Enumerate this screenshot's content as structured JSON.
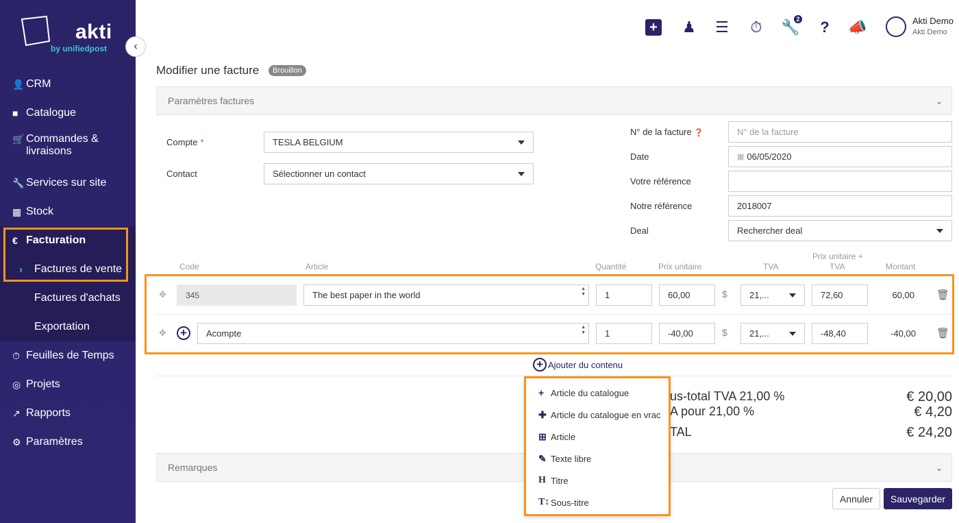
{
  "brand": {
    "name": "akti",
    "subtitle": "by unifiedpost",
    "primary_color": "#2b2367",
    "accent_color": "#3cc6c9",
    "highlight_color": "#f7941d"
  },
  "sidebar": {
    "items": [
      {
        "label": "CRM",
        "icon": "user-icon"
      },
      {
        "label": "Catalogue",
        "icon": "book-icon"
      },
      {
        "label": "Commandes & livraisons",
        "icon": "cart-icon"
      },
      {
        "label": "Services sur site",
        "icon": "wrench-icon"
      },
      {
        "label": "Stock",
        "icon": "cubes-icon"
      },
      {
        "label": "Facturation",
        "icon": "euro-icon"
      },
      {
        "label": "Feuilles de Temps",
        "icon": "stopwatch-icon"
      },
      {
        "label": "Projets",
        "icon": "target-icon"
      },
      {
        "label": "Rapports",
        "icon": "chart-icon"
      },
      {
        "label": "Paramètres",
        "icon": "gear-icon"
      }
    ],
    "facturation_sub": [
      {
        "label": "Factures de vente"
      },
      {
        "label": "Factures d'achats"
      },
      {
        "label": "Exportation"
      }
    ]
  },
  "topbar": {
    "notifications_badge": "2",
    "user_name": "Akti Demo",
    "user_org": "Akti Demo"
  },
  "page": {
    "title": "Modifier une facture",
    "status": "Brouillon"
  },
  "params_panel": {
    "title": "Paramètres factures"
  },
  "form": {
    "compte_label": "Compte",
    "required_mark": "*",
    "compte_value": "TESLA BELGIUM",
    "contact_label": "Contact",
    "contact_placeholder": "Sélectionner un contact",
    "invoice_no_label": "N° de la facture",
    "invoice_no_placeholder": "N° de la facture",
    "date_label": "Date",
    "date_value": "06/05/2020",
    "votre_ref_label": "Votre référence",
    "votre_ref_value": "",
    "notre_ref_label": "Notre référence",
    "notre_ref_value": "2018007",
    "deal_label": "Deal",
    "deal_placeholder": "Rechercher deal"
  },
  "lines_table": {
    "columns": [
      "Code",
      "Article",
      "Quantité",
      "Prix unitaire",
      "TVA",
      "Prix unitaire +",
      "TVA",
      "Montant"
    ],
    "rows": [
      {
        "code": "345",
        "article": "The best paper in the world",
        "qty": "1",
        "unit_price": "60,00",
        "vat": "21,...",
        "unit_price_vat": "72,60",
        "amount": "60,00"
      },
      {
        "code": "",
        "article": "Acompte",
        "qty": "1",
        "unit_price": "-40,00",
        "vat": "21,...",
        "unit_price_vat": "-48,40",
        "amount": "-40,00"
      }
    ],
    "add_content_label": "Ajouter du contenu"
  },
  "add_menu": {
    "items": [
      {
        "label": "Article du catalogue",
        "icon": "plus-icon"
      },
      {
        "label": "Article du catalogue en vrac",
        "icon": "plus-square-icon"
      },
      {
        "label": "Article",
        "icon": "plus-square-outline-icon"
      },
      {
        "label": "Texte libre",
        "icon": "pencil-icon"
      },
      {
        "label": "Titre",
        "icon": "heading-icon"
      },
      {
        "label": "Sous-titre",
        "icon": "text-height-icon"
      }
    ]
  },
  "totals": {
    "subtotal_label": "us-total  TVA 21,00 %",
    "subtotal_value": "€ 20,00",
    "vat_label": "A pour 21,00 %",
    "vat_value": "€ 4,20",
    "total_label": "TAL",
    "total_value": "€ 24,20"
  },
  "remarks_panel": {
    "title": "Remarques"
  },
  "actions": {
    "cancel_label": "Annuler",
    "save_label": "Sauvegarder"
  }
}
